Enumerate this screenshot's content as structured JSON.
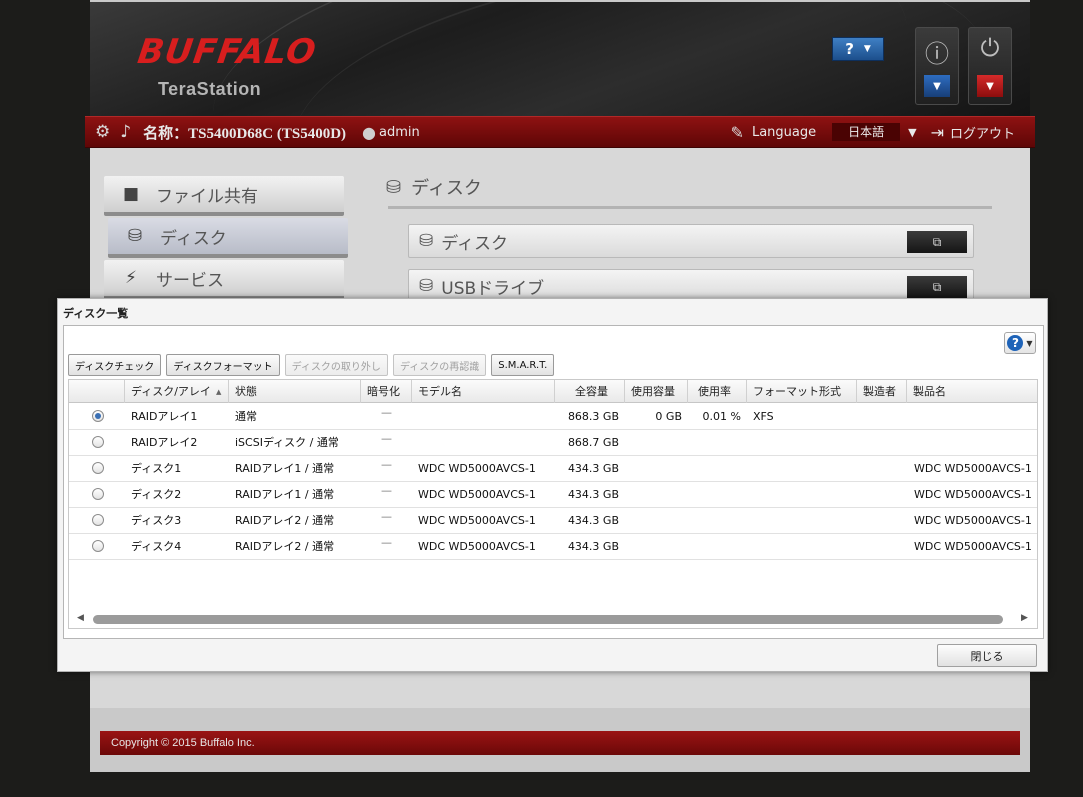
{
  "app": {
    "brand": "BUFFALO",
    "product": "TeraStation",
    "help_label": "?",
    "device_label": "名称：TS5400D68C (TS5400D)",
    "user": "admin",
    "language_label": "Language",
    "language_value": "日本語",
    "logout_label": "ログアウト",
    "footer": "Copyright © 2015 Buffalo Inc."
  },
  "sidebar": {
    "items": [
      {
        "label": "ファイル共有",
        "icon": "folder-icon"
      },
      {
        "label": "ディスク",
        "icon": "database-icon"
      },
      {
        "label": "サービス",
        "icon": "service-icon"
      }
    ]
  },
  "content": {
    "title": "ディスク",
    "panels": [
      {
        "label": "ディスク",
        "icon": "database-icon"
      },
      {
        "label": "USBドライブ",
        "icon": "usb-drive-icon"
      }
    ]
  },
  "dialog": {
    "title": "ディスク一覧",
    "help_label": "?",
    "close_label": "閉じる",
    "toolbar": {
      "disk_check": "ディスクチェック",
      "disk_format": "ディスクフォーマット",
      "disk_remove": "ディスクの取り外し",
      "disk_rescan": "ディスクの再認識",
      "smart": "S.M.A.R.T."
    },
    "columns": {
      "name": "ディスク/アレイ",
      "status": "状態",
      "encryption": "暗号化",
      "model": "モデル名",
      "capacity": "全容量",
      "used": "使用容量",
      "usage": "使用率",
      "format": "フォーマット形式",
      "maker": "製造者",
      "product": "製品名"
    },
    "rows": [
      {
        "name": "RAIDアレイ1",
        "status": "通常",
        "encryption": "—",
        "model": "",
        "capacity": "868.3 GB",
        "used": "0 GB",
        "usage": "0.01 %",
        "format": "XFS",
        "maker": "",
        "product": ""
      },
      {
        "name": "RAIDアレイ2",
        "status": "iSCSIディスク / 通常",
        "encryption": "—",
        "model": "",
        "capacity": "868.7 GB",
        "used": "",
        "usage": "",
        "format": "",
        "maker": "",
        "product": ""
      },
      {
        "name": "ディスク1",
        "status": "RAIDアレイ1 / 通常",
        "encryption": "—",
        "model": "WDC WD5000AVCS-1",
        "capacity": "434.3 GB",
        "used": "",
        "usage": "",
        "format": "",
        "maker": "",
        "product": "WDC WD5000AVCS-1"
      },
      {
        "name": "ディスク2",
        "status": "RAIDアレイ1 / 通常",
        "encryption": "—",
        "model": "WDC WD5000AVCS-1",
        "capacity": "434.3 GB",
        "used": "",
        "usage": "",
        "format": "",
        "maker": "",
        "product": "WDC WD5000AVCS-1"
      },
      {
        "name": "ディスク3",
        "status": "RAIDアレイ2 / 通常",
        "encryption": "—",
        "model": "WDC WD5000AVCS-1",
        "capacity": "434.3 GB",
        "used": "",
        "usage": "",
        "format": "",
        "maker": "",
        "product": "WDC WD5000AVCS-1"
      },
      {
        "name": "ディスク4",
        "status": "RAIDアレイ2 / 通常",
        "encryption": "—",
        "model": "WDC WD5000AVCS-1",
        "capacity": "434.3 GB",
        "used": "",
        "usage": "",
        "format": "",
        "maker": "",
        "product": "WDC WD5000AVCS-1"
      }
    ]
  }
}
